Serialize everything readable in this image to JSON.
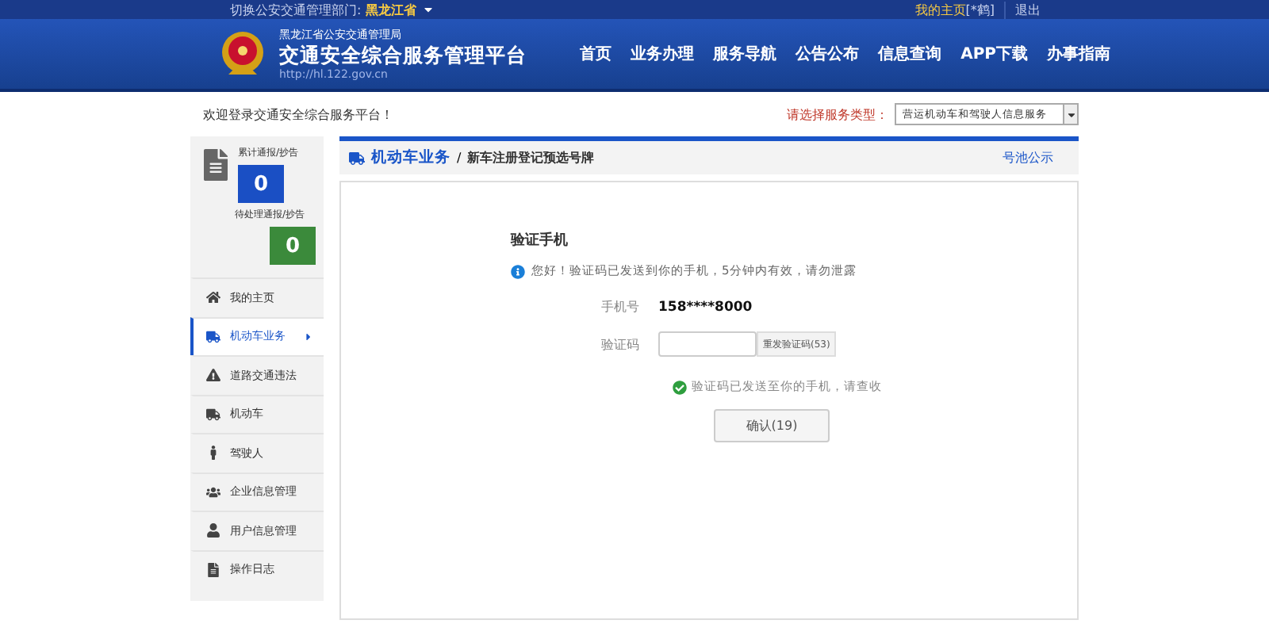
{
  "top_bar": {
    "department_label": "切换公安交通管理部门:",
    "department": "黑龙江省",
    "home_link": "我的主页",
    "user": "[*鹤]",
    "logout": "退出"
  },
  "header": {
    "agency": "黑龙江省公安交通管理局",
    "title": "交通安全综合服务管理平台",
    "url": "http://hl.122.gov.cn",
    "nav": [
      {
        "label": "首页"
      },
      {
        "label": "业务办理"
      },
      {
        "label": "服务导航"
      },
      {
        "label": "公告公布"
      },
      {
        "label": "信息查询"
      },
      {
        "label": "APP下载"
      },
      {
        "label": "办事指南"
      }
    ]
  },
  "welcome": "欢迎登录交通安全综合服务平台！",
  "service_type": {
    "label": "请选择服务类型：",
    "value": "营运机动车和驾驶人信息服务"
  },
  "sidebar": {
    "counters": [
      {
        "label": "累计通报/抄告",
        "count": "0",
        "color": "#1a4fc4"
      },
      {
        "label": "待处理通报/抄告",
        "count": "0",
        "color": "#3b8a3b"
      }
    ],
    "items": [
      {
        "label": "我的主页",
        "selected": false
      },
      {
        "label": "机动车业务",
        "selected": true
      },
      {
        "label": "道路交通违法",
        "selected": false
      },
      {
        "label": "机动车",
        "selected": false
      },
      {
        "label": "驾驶人",
        "selected": false
      },
      {
        "label": "企业信息管理",
        "selected": false
      },
      {
        "label": "用户信息管理",
        "selected": false
      },
      {
        "label": "操作日志",
        "selected": false
      }
    ]
  },
  "breadcrumb": {
    "section": "机动车业务",
    "separator": "/",
    "page": "新车注册登记预选号牌",
    "link": "号池公示"
  },
  "form": {
    "title": "验证手机",
    "notice": "您好！验证码已发送到你的手机，5分钟内有效，请勿泄露",
    "phone_label": "手机号",
    "phone": "158****8000",
    "code_label": "验证码",
    "resend": "重发验证码(53)",
    "success": "验证码已发送至你的手机，请查收",
    "confirm": "确认(19)"
  }
}
